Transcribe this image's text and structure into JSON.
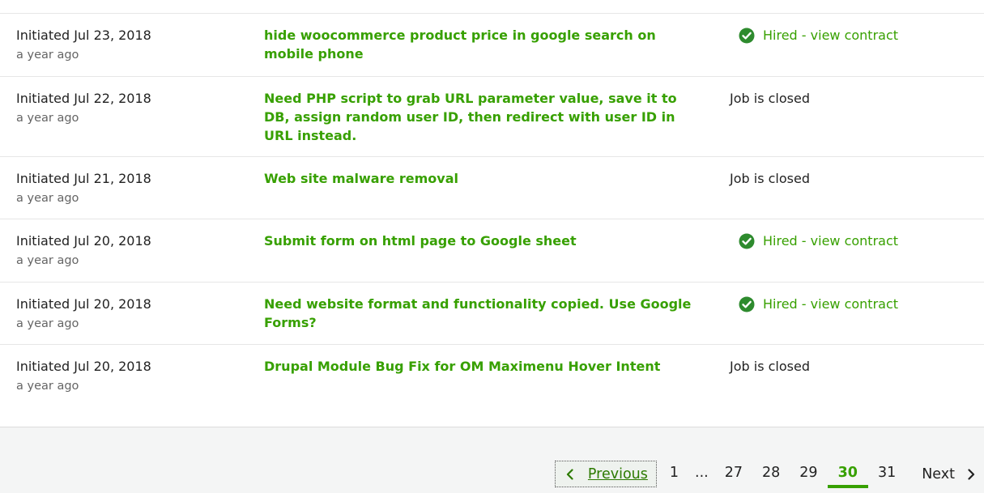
{
  "rows": [
    {
      "date": "Initiated Jul 23, 2018",
      "ago": "a year ago",
      "title": "hide woocommerce product price in google search on mobile phone",
      "status": "Hired - view contract",
      "hired": true
    },
    {
      "date": "Initiated Jul 22, 2018",
      "ago": "a year ago",
      "title": "Need PHP script to grab URL parameter value, save it to DB, assign random user ID, then redirect with user ID in URL instead.",
      "status": "Job is closed",
      "hired": false
    },
    {
      "date": "Initiated Jul 21, 2018",
      "ago": "a year ago",
      "title": "Web site malware removal",
      "status": "Job is closed",
      "hired": false
    },
    {
      "date": "Initiated Jul 20, 2018",
      "ago": "a year ago",
      "title": "Submit form on html page to Google sheet",
      "status": "Hired - view contract",
      "hired": true
    },
    {
      "date": "Initiated Jul 20, 2018",
      "ago": "a year ago",
      "title": "Need website format and functionality copied. Use Google Forms?",
      "status": "Hired - view contract",
      "hired": true
    },
    {
      "date": "Initiated Jul 20, 2018",
      "ago": "a year ago",
      "title": "Drupal Module Bug Fix for OM Maximenu Hover Intent",
      "status": "Job is closed",
      "hired": false
    }
  ],
  "pagination": {
    "previous_label": "Previous",
    "pages": [
      "1",
      "...",
      "27",
      "28",
      "29",
      "30",
      "31"
    ],
    "current": "30",
    "next_label": "Next"
  },
  "colors": {
    "accent": "#37a000",
    "check": "#2e8b2e"
  },
  "icons": {
    "hired": "check-circle-icon",
    "previous": "chevron-left-icon",
    "next": "chevron-right-icon"
  }
}
